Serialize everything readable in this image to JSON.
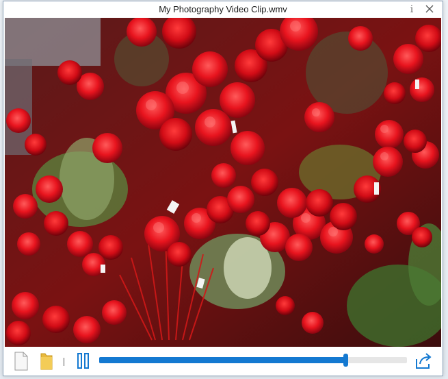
{
  "window": {
    "title": "My Photography Video Clip.wmv"
  },
  "titlebar": {
    "info_icon": "info-icon",
    "close_icon": "close-icon"
  },
  "player": {
    "progress_fraction": 0.8,
    "state": "playing",
    "icons": {
      "file": "blank-file-icon",
      "folder": "folder-icon",
      "pause": "pause-icon",
      "share": "share-icon"
    },
    "accent_color": "#1479d1"
  }
}
